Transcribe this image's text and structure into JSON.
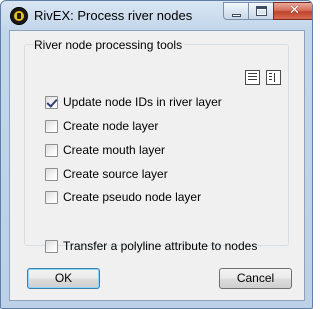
{
  "window": {
    "title": "RivEX: Process river nodes",
    "icon": "rivex-app-icon"
  },
  "caption_buttons": {
    "minimize": "minimize-icon",
    "maximize": "maximize-icon",
    "close_glyph": "✕"
  },
  "group": {
    "label": "River node processing tools",
    "tool_icons": [
      "select-all-icon",
      "select-none-icon"
    ]
  },
  "options": [
    {
      "label": "Update node IDs in river layer",
      "checked": true
    },
    {
      "label": "Create node layer",
      "checked": false
    },
    {
      "label": "Create mouth layer",
      "checked": false
    },
    {
      "label": "Create source layer",
      "checked": false
    },
    {
      "label": "Create pseudo node layer",
      "checked": false
    },
    {
      "label": "Transfer a polyline attribute to nodes",
      "checked": false
    }
  ],
  "buttons": {
    "ok": "OK",
    "cancel": "Cancel"
  }
}
